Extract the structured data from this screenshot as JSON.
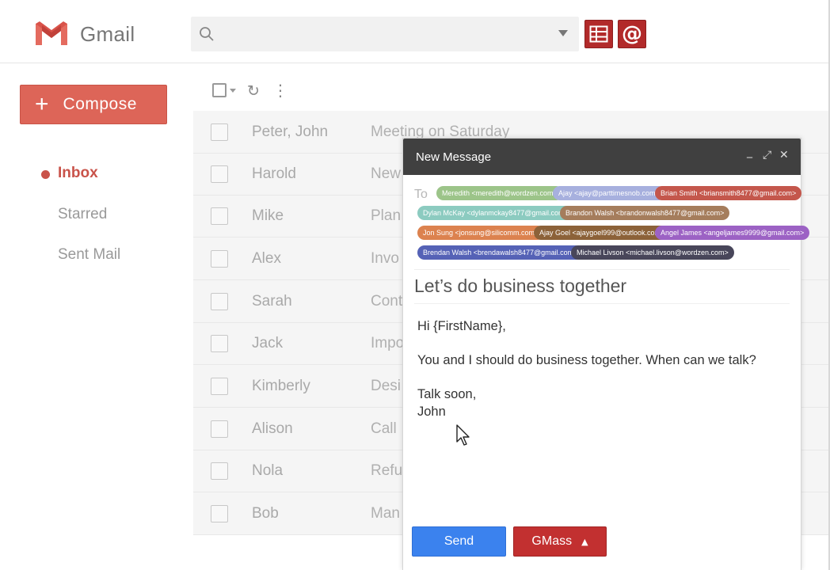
{
  "header": {
    "logo_text": "Gmail",
    "search": {
      "placeholder": "",
      "value": ""
    },
    "accent": "#b22a2a"
  },
  "sidebar": {
    "compose_label": "Compose",
    "items": [
      {
        "label": "Inbox",
        "active": true
      },
      {
        "label": "Starred",
        "active": false
      },
      {
        "label": "Sent Mail",
        "active": false
      }
    ]
  },
  "list": {
    "rows": [
      {
        "sender": "Peter, John",
        "subject": "Meeting on Saturday"
      },
      {
        "sender": "Harold",
        "subject": "New"
      },
      {
        "sender": "Mike",
        "subject": "Plan"
      },
      {
        "sender": "Alex",
        "subject": "Invo"
      },
      {
        "sender": "Sarah",
        "subject": "Cont"
      },
      {
        "sender": "Jack",
        "subject": "Impo"
      },
      {
        "sender": "Kimberly",
        "subject": "Desi"
      },
      {
        "sender": "Alison",
        "subject": "Call"
      },
      {
        "sender": "Nola",
        "subject": "Refu"
      },
      {
        "sender": "Bob",
        "subject": "Man"
      }
    ]
  },
  "compose": {
    "title": "New Message",
    "to_label": "To",
    "recipients": [
      {
        "text": "Meredith <meredith@wordzen.com>",
        "color": "#9cc489"
      },
      {
        "text": "Ajay <ajay@parttimesnob.com>",
        "color": "#a7b0de"
      },
      {
        "text": "Brian Smith <briansmith8477@gmail.com>",
        "color": "#c4574c"
      },
      {
        "text": "Dylan McKay <dylanmckay8477@gmail.com>",
        "color": "#8ccbc0"
      },
      {
        "text": "Brandon Walsh <brandonwalsh8477@gmail.com>",
        "color": "#a57d5c"
      },
      {
        "text": "Jon Sung <jonsung@silicomm.com>",
        "color": "#dc824f"
      },
      {
        "text": "Ajay Goel <ajaygoel999@outlook.com>",
        "color": "#8c6239"
      },
      {
        "text": "Angel James <angeljames9999@gmail.com>",
        "color": "#9c62c4"
      },
      {
        "text": "Brendan Walsh <brendawalsh8477@gmail.com>",
        "color": "#5562b6"
      },
      {
        "text": "Michael Livson <michael.livson@wordzen.com>",
        "color": "#48465a"
      }
    ],
    "subject": "Let’s do business together",
    "body": {
      "greeting": "Hi {FirstName},",
      "line1": "You and I should do business together. When can we talk?",
      "closing": "Talk soon,",
      "signature": "John"
    },
    "send_label": "Send",
    "gmass_label": "GMass",
    "gmass_arrow": "▲"
  }
}
